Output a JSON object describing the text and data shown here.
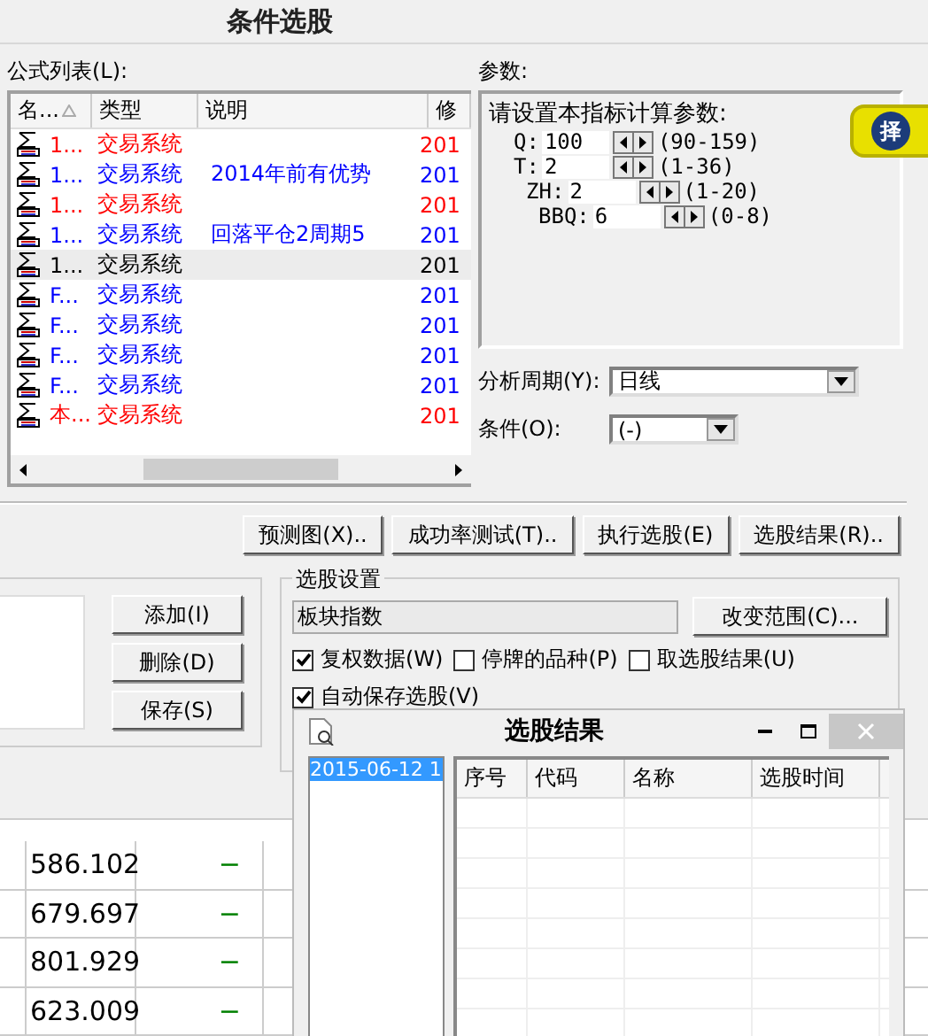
{
  "dialog": {
    "title": "条件选股"
  },
  "formula_list": {
    "label": "公式列表(L):",
    "columns": [
      "名...",
      "类型",
      "说明",
      "修"
    ],
    "rows": [
      {
        "name": "1...",
        "type": "交易系统",
        "date": "201",
        "color": "#ff0000",
        "selected": false
      },
      {
        "name": "1...",
        "type": "交易系统",
        "desc": "2014年前有优势",
        "date": "201",
        "color": "#0000ff",
        "selected": false
      },
      {
        "name": "1...",
        "type": "交易系统",
        "date": "201",
        "color": "#ff0000",
        "selected": false
      },
      {
        "name": "1...",
        "type": "交易系统",
        "desc": "回落平仓2周期5",
        "date": "201",
        "color": "#0000ff",
        "selected": false
      },
      {
        "name": "1...",
        "type": "交易系统",
        "date": "201",
        "color": "#000000",
        "selected": true
      },
      {
        "name": "F...",
        "type": "交易系统",
        "date": "201",
        "color": "#0000ff",
        "selected": false
      },
      {
        "name": "F...",
        "type": "交易系统",
        "date": "201",
        "color": "#0000ff",
        "selected": false
      },
      {
        "name": "F...",
        "type": "交易系统",
        "date": "201",
        "color": "#0000ff",
        "selected": false
      },
      {
        "name": "F...",
        "type": "交易系统",
        "date": "201",
        "color": "#0000ff",
        "selected": false
      },
      {
        "name": "本...",
        "type": "交易系统",
        "date": "201",
        "color": "#ff0000",
        "selected": false
      }
    ]
  },
  "params": {
    "label": "参数:",
    "prompt": "请设置本指标计算参数:",
    "items": [
      {
        "name": "Q:",
        "value": "100",
        "range": "(90-159)"
      },
      {
        "name": "T:",
        "value": "2",
        "range": "(1-36)"
      },
      {
        "name": "ZH:",
        "value": "2",
        "range": "(1-20)"
      },
      {
        "name": "BBQ:",
        "value": "6",
        "range": "(0-8)"
      }
    ]
  },
  "period": {
    "label": "分析周期(Y):",
    "value": "日线"
  },
  "condition": {
    "label": "条件(O):",
    "value": "(-)"
  },
  "badge": {
    "glyph": "择"
  },
  "actions": [
    "预测图(X)..",
    "成功率测试(T)..",
    "执行选股(E)",
    "选股结果(R).."
  ],
  "list_buttons": [
    "添加(I)",
    "删除(D)",
    "保存(S)"
  ],
  "settings": {
    "title": "选股设置",
    "range": "板块指数",
    "range_button": "改变范围(C)...",
    "options": [
      {
        "label": "复权数据(W)",
        "checked": true
      },
      {
        "label": "停牌的品种(P)",
        "checked": false
      },
      {
        "label": "取选股结果(U)",
        "checked": false
      },
      {
        "label": "自动保存选股(V)",
        "checked": true
      }
    ]
  },
  "table": {
    "rows": [
      {
        "value": "586.102",
        "change": "−"
      },
      {
        "value": "679.697",
        "change": "−"
      },
      {
        "value": "801.929",
        "change": "−"
      },
      {
        "value": "623.009",
        "change": "−"
      }
    ]
  },
  "result": {
    "title": "选股结果",
    "dates": [
      {
        "label": "2015-06-12 1",
        "selected": true
      }
    ],
    "columns": [
      "序号",
      "代码",
      "名称",
      "选股时间"
    ]
  }
}
